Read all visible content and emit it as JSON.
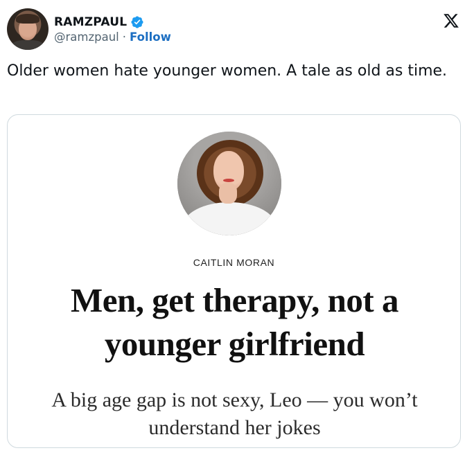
{
  "author": {
    "display_name": "RAMZPAUL",
    "handle": "@ramzpaul",
    "separator": "·",
    "follow_label": "Follow"
  },
  "tweet": {
    "text": "Older women hate younger women. A tale as old as time."
  },
  "card": {
    "author_name": "CAITLIN MORAN",
    "headline": "Men, get therapy, not a younger girlfriend",
    "standfirst": "A big age gap is not sexy, Leo — you won’t understand her jokes"
  },
  "colors": {
    "follow": "#1d6fc2",
    "verified": "#1d9bf0",
    "handle": "#536471",
    "card_border": "#cfd9de"
  },
  "icons": {
    "verified": "verified-badge-icon",
    "platform": "x-logo-icon"
  }
}
